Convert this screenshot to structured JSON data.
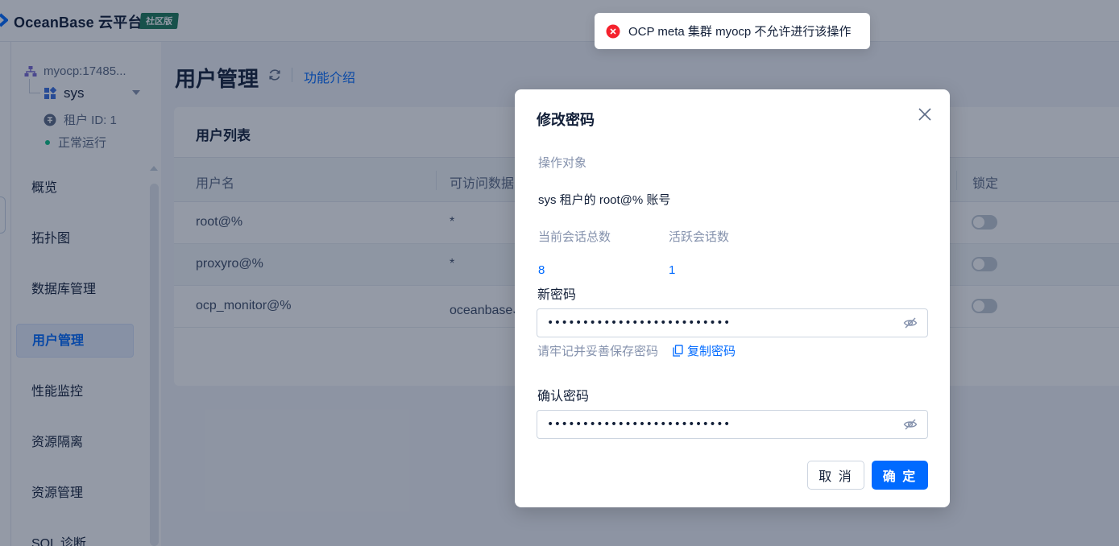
{
  "header": {
    "logo_text": "OceanBase 云平台",
    "edition_badge": "社区版"
  },
  "sidebar": {
    "cluster_label": "myocp:17485...",
    "tenant_name": "sys",
    "tenant_id": "租户 ID: 1",
    "status": "正常运行",
    "menu": [
      {
        "label": "概览",
        "active": false
      },
      {
        "label": "拓扑图",
        "active": false
      },
      {
        "label": "数据库管理",
        "active": false
      },
      {
        "label": "用户管理",
        "active": true
      },
      {
        "label": "性能监控",
        "active": false
      },
      {
        "label": "资源隔离",
        "active": false
      },
      {
        "label": "资源管理",
        "active": false
      },
      {
        "label": "SQL 诊断",
        "active": false
      }
    ]
  },
  "page": {
    "title": "用户管理",
    "intro_link": "功能介绍"
  },
  "user_table": {
    "title": "用户列表",
    "columns": [
      "用户名",
      "可访问数据",
      "锁定"
    ],
    "rows": [
      {
        "username": "root@%",
        "databases": "*",
        "locked": false
      },
      {
        "username": "proxyro@%",
        "databases": "*",
        "locked": false
      },
      {
        "username": "ocp_monitor@%",
        "databases": "oceanbase、",
        "locked": false
      }
    ]
  },
  "modal": {
    "title": "修改密码",
    "target_label": "操作对象",
    "target_value": "sys 租户的 root@% 账号",
    "total_sessions_label": "当前会话总数",
    "total_sessions_value": "8",
    "active_sessions_label": "活跃会话数",
    "active_sessions_value": "1",
    "new_password_label": "新密码",
    "new_password_value": "••••••••••••••••••••••••••",
    "hint": "请牢记并妥善保存密码",
    "copy_label": "复制密码",
    "confirm_password_label": "确认密码",
    "confirm_password_value": "••••••••••••••••••••••••••",
    "cancel_label": "取 消",
    "ok_label": "确 定"
  },
  "toast": {
    "message": "OCP meta 集群 myocp 不允许进行该操作"
  },
  "colors": {
    "primary": "#006aff",
    "error": "#f5222d",
    "status_ok": "#0ac185",
    "badge": "#1c7a5a"
  }
}
